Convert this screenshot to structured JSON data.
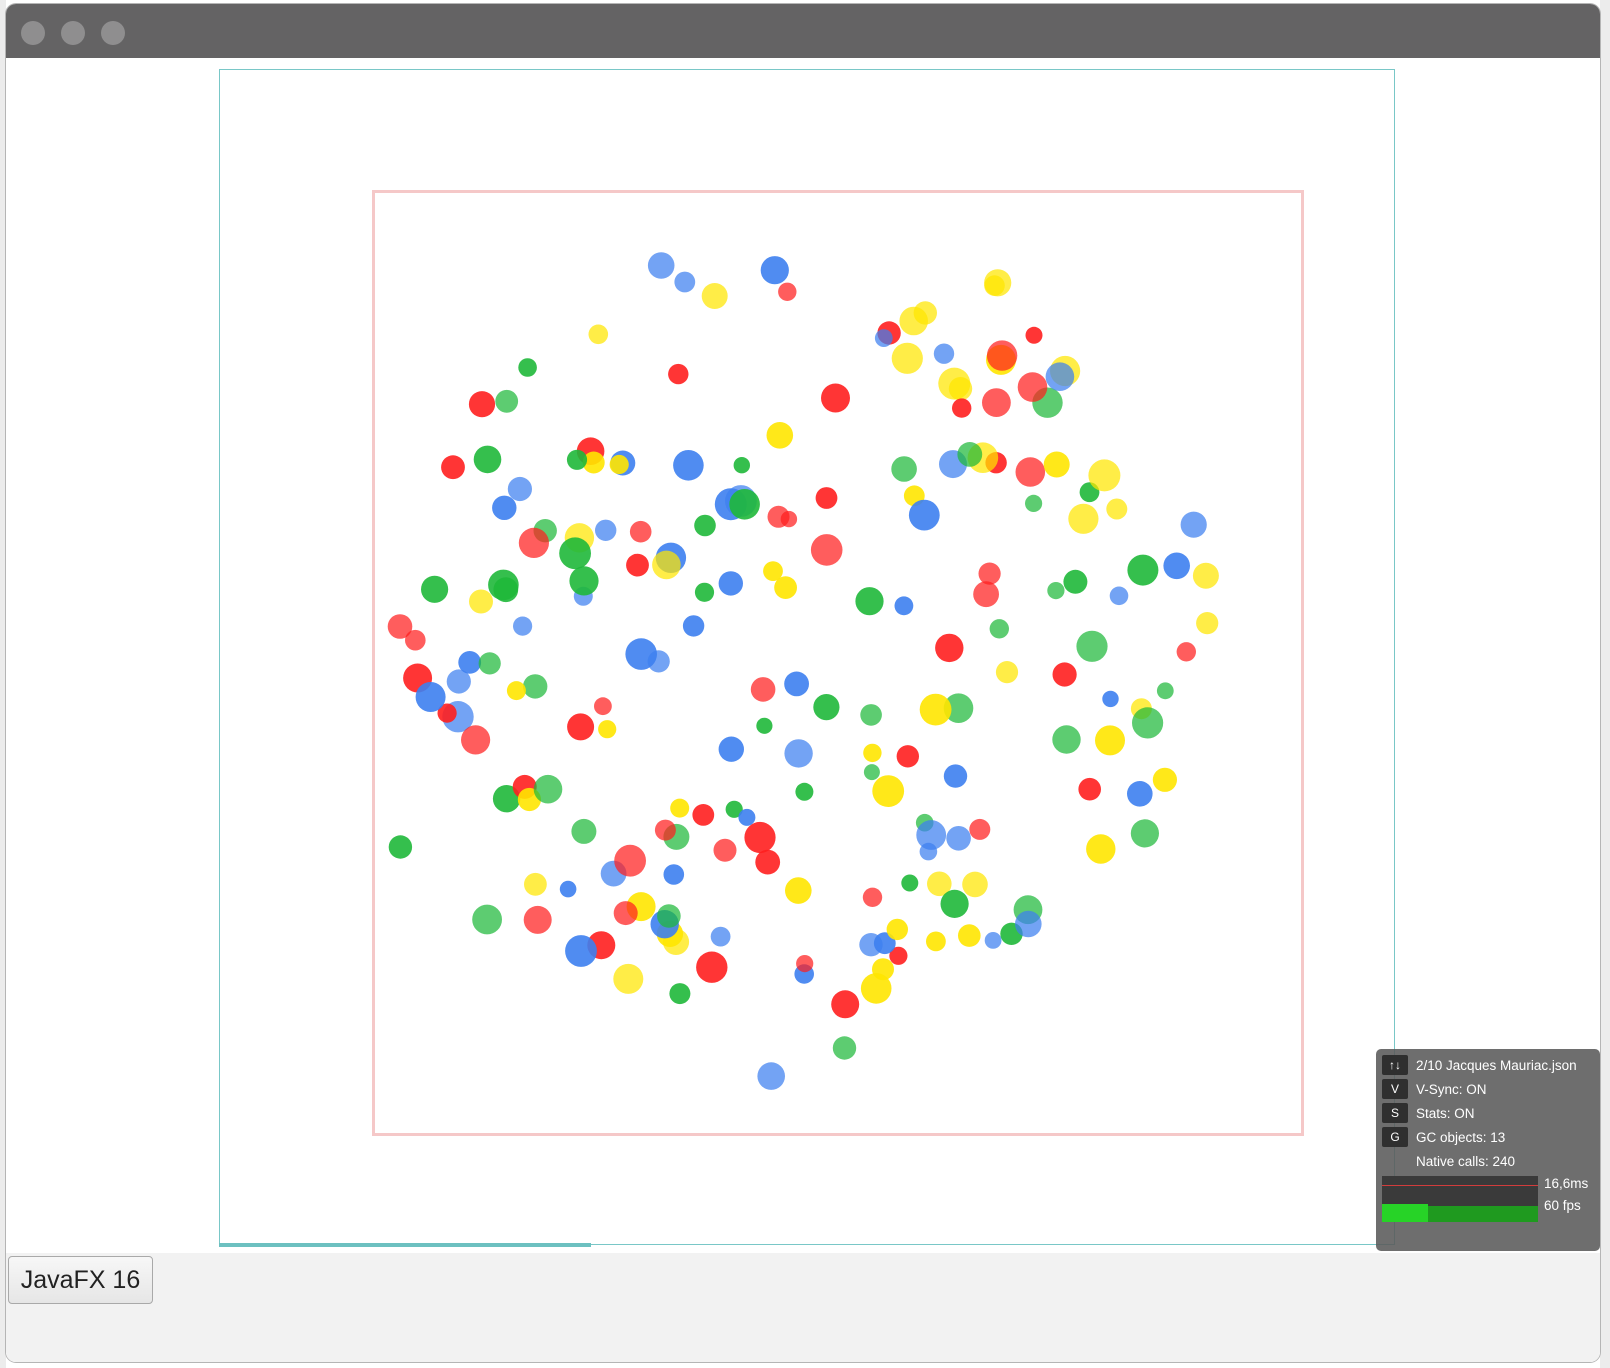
{
  "window": {
    "title": "",
    "traffic_lights": [
      "close",
      "minimize",
      "zoom"
    ]
  },
  "button": {
    "label": "JavaFX 16"
  },
  "stats": {
    "file": {
      "key": "↑↓",
      "text": "2/10 Jacques Mauriac.json"
    },
    "vsync": {
      "key": "V",
      "text": "V-Sync: ON"
    },
    "stats": {
      "key": "S",
      "text": "Stats: ON"
    },
    "gc": {
      "key": "G",
      "text": "GC objects: 13"
    },
    "native": {
      "text": "Native calls: 240"
    },
    "frame_time": "16,6ms",
    "fps": "60 fps"
  },
  "colors": {
    "red": "#ff1f1f",
    "yellow": "#ffe600",
    "blue": "#3d7ff0",
    "green": "#1fb83a",
    "outer_border": "#79c7c7",
    "inner_border": "#f5c8c8"
  },
  "dots": [
    [
      "red",
      0.72
    ],
    [
      "yellow",
      0.72
    ],
    [
      "blue",
      0.72
    ],
    [
      "green",
      0.72
    ],
    [
      "red",
      0.9
    ],
    [
      "yellow",
      0.9
    ],
    [
      "blue",
      0.9
    ],
    [
      "green",
      0.9
    ],
    [
      "red",
      0.72
    ],
    [
      "yellow",
      0.72
    ],
    [
      "blue",
      0.72
    ],
    [
      "green",
      0.72
    ],
    [
      "red",
      0.9
    ],
    [
      "yellow",
      0.9
    ],
    [
      "blue",
      0.9
    ],
    [
      "green",
      0.9
    ],
    [
      "red",
      0.72
    ],
    [
      "yellow",
      0.72
    ],
    [
      "blue",
      0.72
    ],
    [
      "green",
      0.72
    ],
    [
      "red",
      0.9
    ],
    [
      "yellow",
      0.9
    ],
    [
      "blue",
      0.9
    ],
    [
      "green",
      0.9
    ],
    [
      "red",
      0.72
    ],
    [
      "yellow",
      0.72
    ],
    [
      "blue",
      0.72
    ],
    [
      "green",
      0.72
    ],
    [
      "red",
      0.9
    ],
    [
      "yellow",
      0.9
    ],
    [
      "blue",
      0.9
    ],
    [
      "green",
      0.9
    ],
    [
      "red",
      0.72
    ],
    [
      "yellow",
      0.72
    ],
    [
      "blue",
      0.72
    ],
    [
      "green",
      0.72
    ],
    [
      "red",
      0.9
    ],
    [
      "yellow",
      0.9
    ],
    [
      "blue",
      0.9
    ],
    [
      "green",
      0.9
    ],
    [
      "red",
      0.72
    ],
    [
      "yellow",
      0.72
    ],
    [
      "blue",
      0.72
    ],
    [
      "green",
      0.72
    ],
    [
      "red",
      0.9
    ],
    [
      "yellow",
      0.9
    ],
    [
      "blue",
      0.9
    ],
    [
      "green",
      0.9
    ],
    [
      "red",
      0.72
    ],
    [
      "yellow",
      0.72
    ],
    [
      "blue",
      0.72
    ],
    [
      "green",
      0.72
    ],
    [
      "red",
      0.9
    ],
    [
      "yellow",
      0.9
    ],
    [
      "blue",
      0.9
    ],
    [
      "green",
      0.9
    ],
    [
      "red",
      0.72
    ],
    [
      "yellow",
      0.72
    ],
    [
      "blue",
      0.72
    ],
    [
      "green",
      0.72
    ],
    [
      "red",
      0.9
    ],
    [
      "yellow",
      0.9
    ],
    [
      "blue",
      0.9
    ],
    [
      "green",
      0.9
    ],
    [
      "red",
      0.72
    ],
    [
      "yellow",
      0.72
    ],
    [
      "blue",
      0.72
    ],
    [
      "green",
      0.72
    ],
    [
      "red",
      0.9
    ],
    [
      "yellow",
      0.9
    ],
    [
      "blue",
      0.9
    ],
    [
      "green",
      0.9
    ],
    [
      "red",
      0.72
    ],
    [
      "yellow",
      0.72
    ],
    [
      "blue",
      0.72
    ],
    [
      "green",
      0.72
    ],
    [
      "red",
      0.9
    ],
    [
      "yellow",
      0.9
    ],
    [
      "blue",
      0.9
    ],
    [
      "green",
      0.9
    ],
    [
      "red",
      0.72
    ],
    [
      "yellow",
      0.72
    ],
    [
      "blue",
      0.72
    ],
    [
      "green",
      0.72
    ],
    [
      "red",
      0.9
    ],
    [
      "yellow",
      0.9
    ],
    [
      "blue",
      0.9
    ],
    [
      "green",
      0.9
    ],
    [
      "red",
      0.72
    ],
    [
      "yellow",
      0.72
    ],
    [
      "blue",
      0.72
    ],
    [
      "green",
      0.72
    ],
    [
      "red",
      0.9
    ],
    [
      "yellow",
      0.9
    ],
    [
      "blue",
      0.9
    ],
    [
      "green",
      0.9
    ],
    [
      "red",
      0.72
    ],
    [
      "yellow",
      0.72
    ],
    [
      "blue",
      0.72
    ],
    [
      "green",
      0.72
    ],
    [
      "red",
      0.9
    ],
    [
      "yellow",
      0.9
    ],
    [
      "blue",
      0.9
    ],
    [
      "green",
      0.9
    ],
    [
      "red",
      0.72
    ],
    [
      "yellow",
      0.72
    ],
    [
      "blue",
      0.72
    ],
    [
      "green",
      0.72
    ],
    [
      "red",
      0.9
    ],
    [
      "yellow",
      0.9
    ],
    [
      "blue",
      0.9
    ],
    [
      "green",
      0.9
    ],
    [
      "red",
      0.72
    ],
    [
      "yellow",
      0.72
    ],
    [
      "blue",
      0.72
    ],
    [
      "green",
      0.72
    ],
    [
      "red",
      0.9
    ],
    [
      "yellow",
      0.9
    ],
    [
      "blue",
      0.9
    ],
    [
      "green",
      0.9
    ],
    [
      "red",
      0.72
    ],
    [
      "yellow",
      0.72
    ],
    [
      "blue",
      0.72
    ],
    [
      "green",
      0.72
    ],
    [
      "red",
      0.9
    ],
    [
      "yellow",
      0.9
    ],
    [
      "blue",
      0.9
    ],
    [
      "green",
      0.9
    ],
    [
      "red",
      0.72
    ],
    [
      "yellow",
      0.72
    ],
    [
      "blue",
      0.72
    ],
    [
      "green",
      0.72
    ],
    [
      "red",
      0.9
    ],
    [
      "yellow",
      0.9
    ],
    [
      "blue",
      0.9
    ],
    [
      "green",
      0.9
    ],
    [
      "red",
      0.72
    ],
    [
      "yellow",
      0.72
    ],
    [
      "blue",
      0.72
    ],
    [
      "green",
      0.72
    ],
    [
      "red",
      0.9
    ],
    [
      "yellow",
      0.9
    ],
    [
      "blue",
      0.9
    ],
    [
      "green",
      0.9
    ],
    [
      "red",
      0.72
    ],
    [
      "yellow",
      0.72
    ],
    [
      "blue",
      0.72
    ],
    [
      "green",
      0.72
    ],
    [
      "red",
      0.9
    ],
    [
      "yellow",
      0.9
    ],
    [
      "blue",
      0.9
    ],
    [
      "green",
      0.9
    ],
    [
      "red",
      0.72
    ],
    [
      "yellow",
      0.72
    ],
    [
      "blue",
      0.72
    ],
    [
      "green",
      0.72
    ],
    [
      "red",
      0.9
    ],
    [
      "yellow",
      0.9
    ],
    [
      "blue",
      0.9
    ],
    [
      "green",
      0.9
    ],
    [
      "red",
      0.72
    ],
    [
      "yellow",
      0.72
    ],
    [
      "blue",
      0.72
    ],
    [
      "green",
      0.72
    ],
    [
      "red",
      0.9
    ],
    [
      "yellow",
      0.9
    ],
    [
      "blue",
      0.9
    ],
    [
      "green",
      0.9
    ],
    [
      "red",
      0.72
    ],
    [
      "yellow",
      0.72
    ],
    [
      "blue",
      0.72
    ],
    [
      "green",
      0.72
    ],
    [
      "red",
      0.9
    ],
    [
      "yellow",
      0.9
    ],
    [
      "blue",
      0.9
    ],
    [
      "green",
      0.9
    ],
    [
      "red",
      0.72
    ],
    [
      "yellow",
      0.72
    ],
    [
      "blue",
      0.72
    ],
    [
      "green",
      0.72
    ],
    [
      "red",
      0.9
    ],
    [
      "yellow",
      0.9
    ],
    [
      "blue",
      0.9
    ],
    [
      "green",
      0.9
    ],
    [
      "red",
      0.72
    ],
    [
      "yellow",
      0.72
    ],
    [
      "blue",
      0.72
    ],
    [
      "green",
      0.72
    ],
    [
      "red",
      0.9
    ],
    [
      "yellow",
      0.9
    ],
    [
      "blue",
      0.9
    ],
    [
      "green",
      0.9
    ],
    [
      "red",
      0.72
    ],
    [
      "yellow",
      0.72
    ],
    [
      "blue",
      0.72
    ],
    [
      "green",
      0.72
    ],
    [
      "red",
      0.9
    ],
    [
      "yellow",
      0.9
    ],
    [
      "blue",
      0.9
    ],
    [
      "green",
      0.9
    ],
    [
      "red",
      0.72
    ],
    [
      "yellow",
      0.72
    ],
    [
      "blue",
      0.72
    ],
    [
      "green",
      0.72
    ],
    [
      "red",
      0.9
    ],
    [
      "yellow",
      0.9
    ],
    [
      "blue",
      0.9
    ],
    [
      "green",
      0.9
    ]
  ]
}
